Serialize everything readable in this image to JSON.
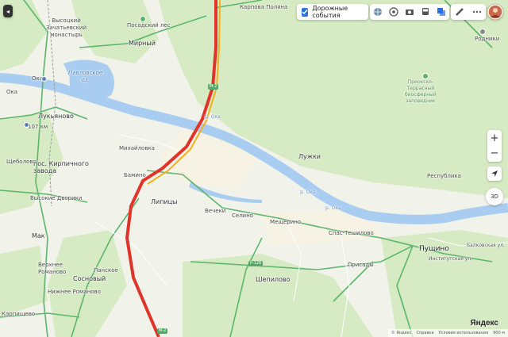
{
  "toolbar": {
    "traffic_label": "Дорожные события"
  },
  "zoom": {
    "plus": "+",
    "minus": "−",
    "three_d": "3D"
  },
  "places": {
    "vysotsky": "Высоцкий\nЗачатьевский\nмонастырь",
    "posadsky": "Посадский лес",
    "mirny": "Мирный",
    "karpova": "Карпова Поляна",
    "rodniki": "Родники",
    "pavlovskoe": "Павловское\nоз.",
    "oka1": "Ока",
    "oka2": "Ока",
    "lukyanovo": "Лукьяново",
    "km107": "107 км",
    "shchebotovo": "Щеболово",
    "kirpichny": "пос. Кирпичного\nзавода",
    "mikhailovka": "Михайловка",
    "bamino": "Бамино",
    "vysokie": "Высокие Дворики",
    "lipitsy": "Липицы",
    "vechki": "Вечеки",
    "selino": "Селино",
    "meshcherino": "Мещерино",
    "luzhki": "Лужки",
    "respublika": "Республика",
    "spas": "Спас-Тешилово",
    "pushchino": "Пущино",
    "prisady": "Присады",
    "shepilovo": "Шепилово",
    "mak": "Мак",
    "verkhnee": "Верхнее\nРоманово",
    "nizhnee": "Нижнее Романово",
    "sosnovy": "Сосновый",
    "panskoe": "Панское",
    "karpishchevo": "Карпищево",
    "reserve": "Приокско-\nТеррасный\nбиосферный\nзаповедник"
  },
  "rivers": {
    "oka_a": "р. Ока",
    "oka_b": "р. Ока",
    "oka_c": "р. Ока"
  },
  "roads": {
    "m2_shield": "М-2",
    "m2_shield2": "М-2",
    "r126": "Р-126",
    "ul_a": "Балковская ул.",
    "ul_b": "Институтская ул."
  },
  "footer": {
    "yandex": "© Яндекс",
    "help": "Справка",
    "terms": "Условия использования",
    "scale": "900 м"
  },
  "brand": "Яндекс",
  "colors": {
    "traffic_red": "#e0342a",
    "traffic_yellow": "#f2b01e",
    "road_green": "#5bb56a",
    "water": "#a9cdf0",
    "forest": "#d4eac1",
    "accent": "#2b6fe0"
  }
}
